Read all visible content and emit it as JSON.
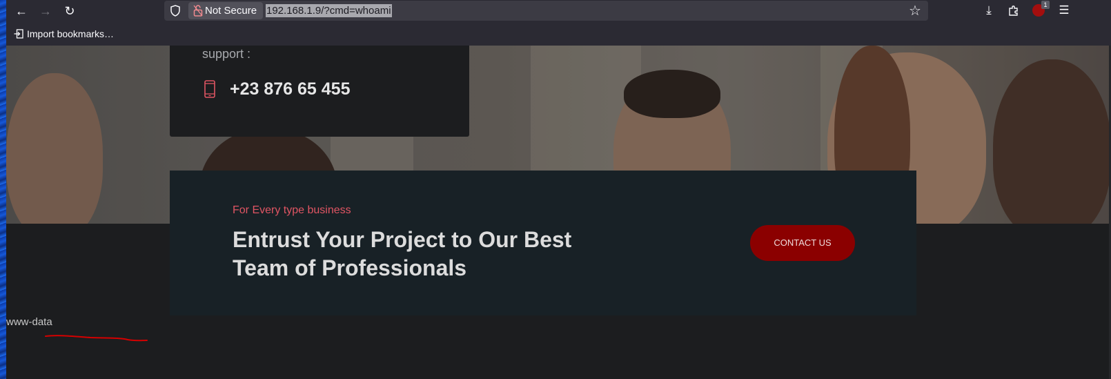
{
  "browser": {
    "security_label": "Not Secure",
    "url": "192.168.1.9/?cmd=whoami",
    "extension_badge": "1",
    "bookmarks": [
      {
        "label": "Import bookmarks…"
      }
    ]
  },
  "colors": {
    "cta_button": "#8b0000",
    "kicker": "#e05563",
    "cta_box": "#182126",
    "page_bg": "#1c1d1f",
    "annotation": "#d60000"
  },
  "contact": {
    "support_label": "support :",
    "phone": "+23 876 65 455"
  },
  "cta": {
    "kicker": "For Every type business",
    "title": "Entrust Your Project to Our Best Team of Professionals",
    "button_label": "CONTACT US"
  },
  "command_output": "www-data"
}
